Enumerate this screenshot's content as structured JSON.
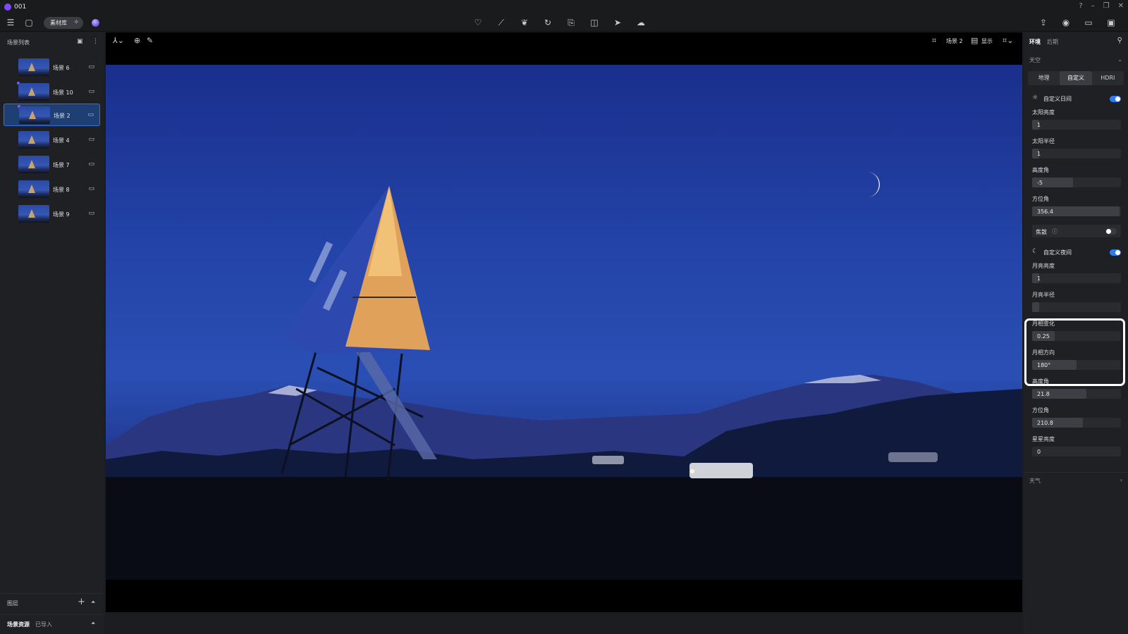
{
  "window": {
    "title": "001"
  },
  "toolbar": {
    "library_label": "素材库",
    "center_tools": [
      "bulb-icon",
      "path-icon",
      "leaf-icon",
      "rotate-icon",
      "import-icon",
      "clip-icon",
      "select-icon",
      "cloud-icon"
    ],
    "right_tools": [
      "share-icon",
      "camera-icon",
      "video-icon",
      "layout-icon"
    ]
  },
  "scene_list": {
    "title": "场景列表",
    "items": [
      {
        "label": "场景 6",
        "active": false
      },
      {
        "label": "场景 10",
        "active": false
      },
      {
        "label": "场景 2",
        "active": true
      },
      {
        "label": "场景 4",
        "active": false
      },
      {
        "label": "场景 7",
        "active": false
      },
      {
        "label": "场景 8",
        "active": false
      },
      {
        "label": "场景 9",
        "active": false
      }
    ]
  },
  "layers": {
    "title": "图层"
  },
  "assets": {
    "tab1": "场景资源",
    "tab2": "已导入"
  },
  "viewport": {
    "scene_name": "场景 2",
    "display_label": "显示"
  },
  "right_panel": {
    "tab_env": "环境",
    "tab_post": "后期",
    "sky_section": "天空",
    "sky_modes": [
      "地理",
      "自定义",
      "HDRI"
    ],
    "sky_mode_selected": "自定义",
    "day": {
      "title": "自定义日间",
      "enabled": true,
      "params": [
        {
          "label": "太阳亮度",
          "value": "1",
          "fraction": 0.0
        },
        {
          "label": "太阳半径",
          "value": "1",
          "fraction": 0.0
        },
        {
          "label": "高度角",
          "value": "-5",
          "fraction": 0.45
        },
        {
          "label": "方位角",
          "value": "356.4",
          "fraction": 0.99
        }
      ],
      "caustics_label": "焦散",
      "caustics_enabled": false
    },
    "night": {
      "title": "自定义夜间",
      "enabled": true,
      "params": [
        {
          "label": "月亮亮度",
          "value": "1",
          "fraction": 0.0
        },
        {
          "label": "月亮半径",
          "value": "",
          "fraction": 0.0
        },
        {
          "label": "月相变化",
          "value": "0.25",
          "fraction": 0.25
        },
        {
          "label": "月相方向",
          "value": "180°",
          "fraction": 0.5
        },
        {
          "label": "高度角",
          "value": "21.8",
          "fraction": 0.6
        },
        {
          "label": "方位角",
          "value": "210.8",
          "fraction": 0.57
        },
        {
          "label": "星星亮度",
          "value": "0",
          "fraction": 0.0
        }
      ]
    },
    "weather_section": "天气"
  },
  "colors": {
    "accent": "#2f7bf0",
    "active_scene": "#1e3f74",
    "sky": "#2343a8"
  }
}
